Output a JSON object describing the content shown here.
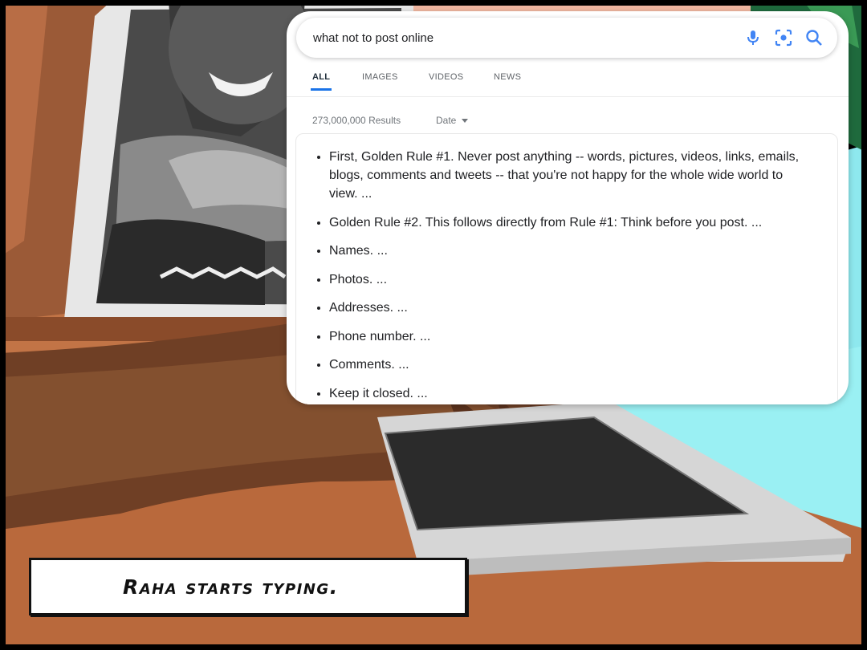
{
  "search": {
    "query": "what not to post online",
    "icons": [
      "mic-icon",
      "lens-icon",
      "search-icon"
    ]
  },
  "tabs": [
    {
      "label": "ALL",
      "active": true
    },
    {
      "label": "IMAGES",
      "active": false
    },
    {
      "label": "VIDEOS",
      "active": false
    },
    {
      "label": "NEWS",
      "active": false
    }
  ],
  "results": {
    "count": "273,000,000 Results",
    "date_filter": "Date"
  },
  "snippet": {
    "items": [
      "First, Golden Rule #1. Never post anything -- words, pictures, videos, links, emails, blogs, comments and tweets -- that you're not happy for the whole wide world to view. ...",
      "Golden Rule #2. This follows directly from Rule #1: Think before you post. ...",
      "Names. ...",
      "Photos. ...",
      "Addresses. ...",
      "Phone number. ...",
      "Comments. ...",
      "Keep it closed. ..."
    ]
  },
  "caption": {
    "text": "Raha starts typing."
  },
  "colors": {
    "accent": "#1a73e8",
    "skin": "#7a4a2c",
    "desk": "#c87a4a",
    "teal": "#8fe9ee"
  }
}
